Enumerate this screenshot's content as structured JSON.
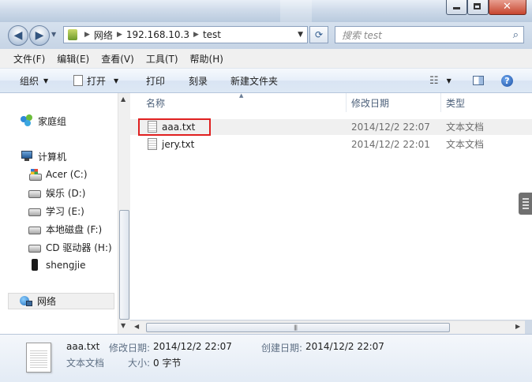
{
  "address": {
    "path": [
      "网络",
      "192.168.10.3",
      "test"
    ]
  },
  "search": {
    "placeholder": "搜索 test"
  },
  "menu": [
    "文件(F)",
    "编辑(E)",
    "查看(V)",
    "工具(T)",
    "帮助(H)"
  ],
  "toolbar": {
    "organize": "组织",
    "open": "打开",
    "print": "打印",
    "burn": "刻录",
    "new_folder": "新建文件夹"
  },
  "nav": {
    "homegroup": "家庭组",
    "computer": "计算机",
    "drives": [
      "Acer (C:)",
      "娱乐 (D:)",
      "学习 (E:)",
      "本地磁盘 (F:)",
      "CD 驱动器 (H:)",
      "shengjie"
    ],
    "network": "网络"
  },
  "columns": {
    "name": "名称",
    "modified": "修改日期",
    "type": "类型"
  },
  "files": [
    {
      "name": "aaa.txt",
      "modified": "2014/12/2 22:07",
      "type": "文本文档"
    },
    {
      "name": "jery.txt",
      "modified": "2014/12/2 22:01",
      "type": "文本文档"
    }
  ],
  "details": {
    "filename": "aaa.txt",
    "modified_label": "修改日期:",
    "modified_value": "2014/12/2 22:07",
    "created_label": "创建日期:",
    "created_value": "2014/12/2 22:07",
    "type": "文本文档",
    "size_label": "大小:",
    "size_value": "0 字节"
  },
  "colors": {
    "selection_outline": "#e02020",
    "selected_row": "#f0f0f0"
  }
}
